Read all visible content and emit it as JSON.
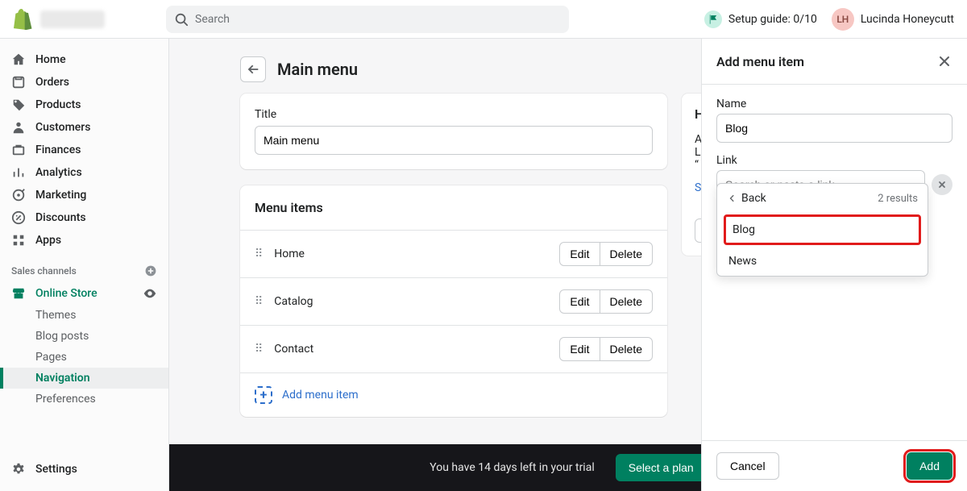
{
  "topbar": {
    "search_placeholder": "Search",
    "setup_guide_label": "Setup guide: 0/10",
    "user_initials": "LH",
    "user_name": "Lucinda Honeycutt"
  },
  "sidebar": {
    "items": [
      {
        "label": "Home"
      },
      {
        "label": "Orders"
      },
      {
        "label": "Products"
      },
      {
        "label": "Customers"
      },
      {
        "label": "Finances"
      },
      {
        "label": "Analytics"
      },
      {
        "label": "Marketing"
      },
      {
        "label": "Discounts"
      },
      {
        "label": "Apps"
      }
    ],
    "sales_channels_label": "Sales channels",
    "online_store_label": "Online Store",
    "subnav": [
      {
        "label": "Themes"
      },
      {
        "label": "Blog posts"
      },
      {
        "label": "Pages"
      },
      {
        "label": "Navigation",
        "active": true
      },
      {
        "label": "Preferences"
      }
    ],
    "settings_label": "Settings"
  },
  "page": {
    "title": "Main menu",
    "title_label": "Title",
    "title_value": "Main menu",
    "menu_items_heading": "Menu items",
    "menu_items": [
      {
        "name": "Home"
      },
      {
        "name": "Catalog"
      },
      {
        "name": "Contact"
      }
    ],
    "edit_label": "Edit",
    "delete_label": "Delete",
    "add_menu_item_label": "Add menu item"
  },
  "help_card": {
    "heading_first_letter": "H",
    "line1_first_letter": "A",
    "line2_first_letter": "L",
    "line3_first_char": "“",
    "link_first_letter": "S"
  },
  "drawer": {
    "title": "Add menu item",
    "name_label": "Name",
    "name_value": "Blog",
    "link_label": "Link",
    "link_placeholder": "Search or paste a link",
    "dropdown": {
      "back_label": "Back",
      "results_label": "2 results",
      "options": [
        {
          "label": "Blog",
          "highlight": true
        },
        {
          "label": "News"
        }
      ]
    },
    "cancel_label": "Cancel",
    "add_label": "Add"
  },
  "trial": {
    "message": "You have 14 days left in your trial",
    "button": "Select a plan"
  }
}
